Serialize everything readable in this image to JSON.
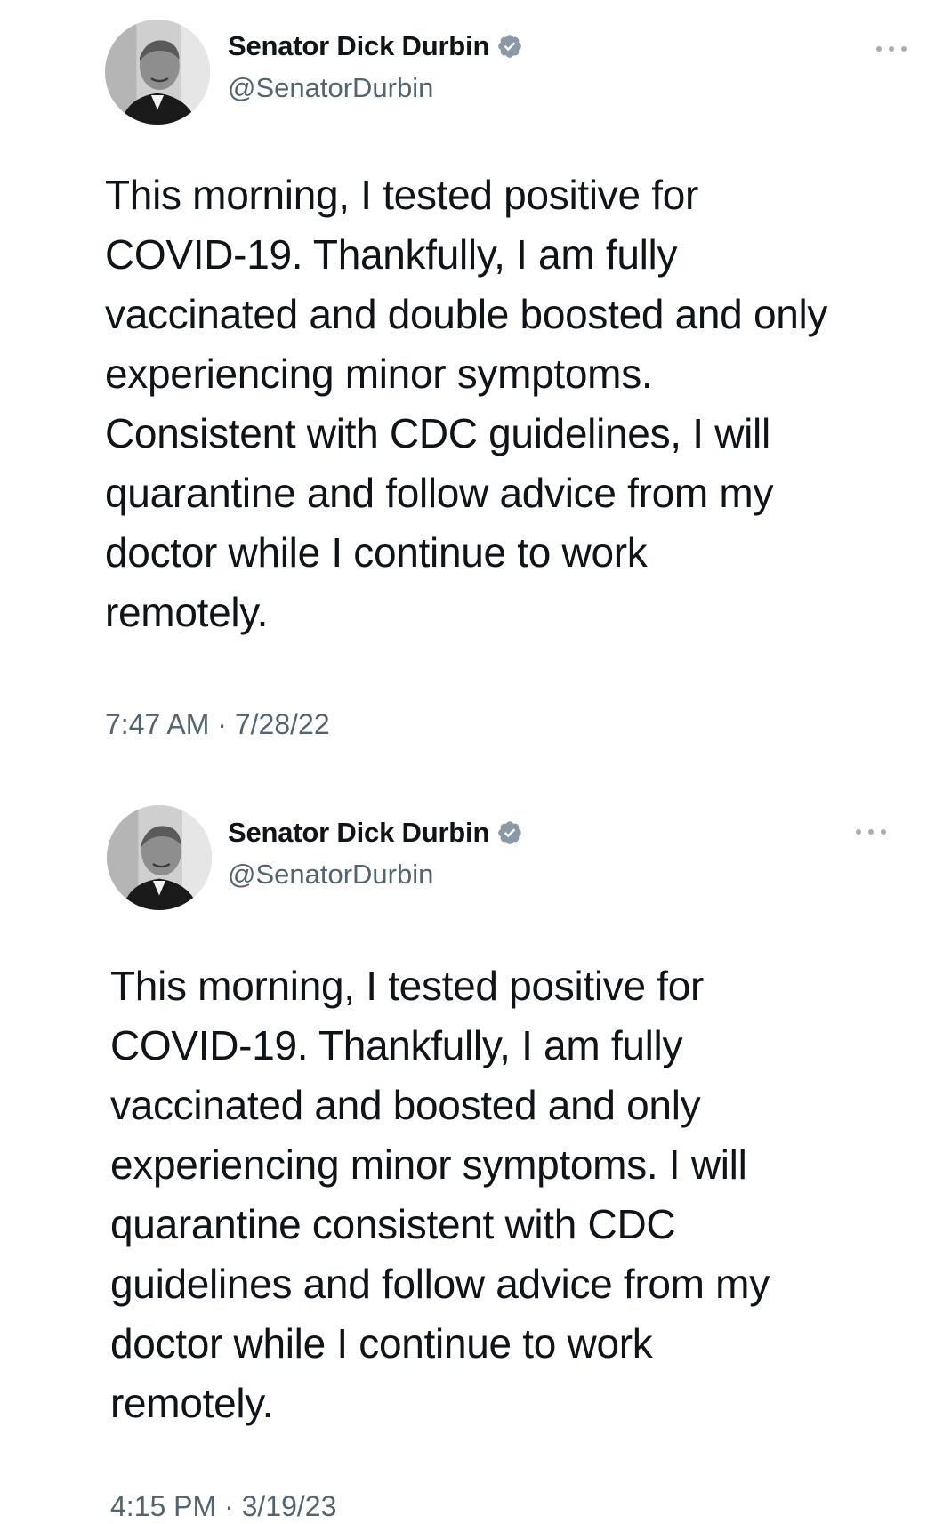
{
  "tweets": [
    {
      "author": {
        "display_name": "Senator Dick Durbin",
        "handle": "@SenatorDurbin",
        "verified": true,
        "avatar_icon": "avatar-photo"
      },
      "text": "This morning, I tested positive for\nCOVID-19. Thankfully, I am fully\nvaccinated and double boosted and only\nexperiencing minor symptoms.\nConsistent with CDC guidelines, I will\nquarantine and follow advice from my\ndoctor while I continue to work\nremotely.",
      "timestamp": "7:47 AM · 7/28/22"
    },
    {
      "author": {
        "display_name": "Senator Dick Durbin",
        "handle": "@SenatorDurbin",
        "verified": true,
        "avatar_icon": "avatar-photo"
      },
      "text": "This morning, I tested positive for\nCOVID-19. Thankfully, I am fully\nvaccinated and boosted and only\nexperiencing minor symptoms. I will\nquarantine consistent with CDC\nguidelines and follow advice from my\ndoctor while I continue to work\nremotely.",
      "timestamp": "4:15 PM · 3/19/23"
    }
  ],
  "colors": {
    "text_primary": "#0f1419",
    "text_secondary": "#536471",
    "verified_badge": "#8b98a5",
    "background": "#ffffff"
  }
}
